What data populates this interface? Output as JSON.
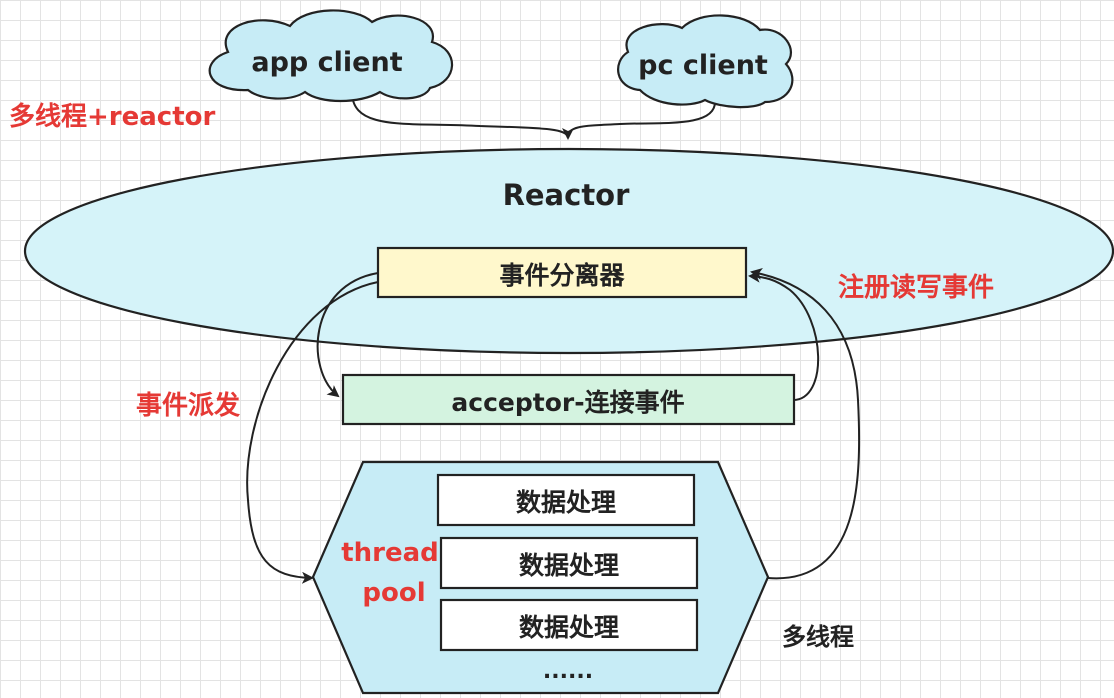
{
  "nodes": {
    "app_client": "app client",
    "pc_client": "pc client",
    "reactor": "Reactor",
    "demultiplexer": "事件分离器",
    "acceptor": "acceptor-连接事件",
    "thread_pool": [
      "thread",
      "pool"
    ],
    "workers": [
      "数据处理",
      "数据处理",
      "数据处理"
    ],
    "ellipsis": "......"
  },
  "labels": {
    "title": "多线程+reactor",
    "register_events": "注册读写事件",
    "dispatch_events": "事件派发",
    "multithread": "多线程"
  },
  "colors": {
    "cloud_fill": "#c7ecf6",
    "reactor_fill": "#d5f3f9",
    "demultiplexer_fill": "#fff8cc",
    "acceptor_fill": "#d4f3e0",
    "pool_fill": "#c7ecf6",
    "worker_fill": "#ffffff",
    "label_red": "#e53935",
    "stroke": "#222222"
  }
}
